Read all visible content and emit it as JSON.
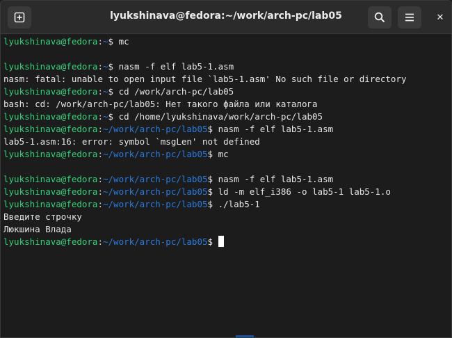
{
  "window": {
    "title": "lyukshinava@fedora:~/work/arch-pc/lab05",
    "buttons": {
      "new_tab_icon": "plus-square-icon",
      "search_icon": "search-icon",
      "menu_icon": "hamburger-icon",
      "close_icon": "close-icon",
      "close_glyph": "✕"
    }
  },
  "terminal": {
    "lines": [
      {
        "user": "lyukshinava@fedora",
        "sep": ":",
        "path": "~",
        "cmd": "$ mc"
      },
      {
        "text": ""
      },
      {
        "user": "lyukshinava@fedora",
        "sep": ":",
        "path": "~",
        "cmd": "$ nasm -f elf lab5-1.asm"
      },
      {
        "text": "nasm: fatal: unable to open input file `lab5-1.asm' No such file or directory"
      },
      {
        "user": "lyukshinava@fedora",
        "sep": ":",
        "path": "~",
        "cmd": "$ cd /work/arch-pc/lab05"
      },
      {
        "text": "bash: cd: /work/arch-pc/lab05: Нет такого файла или каталога"
      },
      {
        "user": "lyukshinava@fedora",
        "sep": ":",
        "path": "~",
        "cmd": "$ cd /home/lyukshinava/work/arch-pc/lab05"
      },
      {
        "user": "lyukshinava@fedora",
        "sep": ":",
        "path": "~/work/arch-pc/lab05",
        "cmd": "$ nasm -f elf lab5-1.asm"
      },
      {
        "text": "lab5-1.asm:16: error: symbol `msgLen' not defined"
      },
      {
        "user": "lyukshinava@fedora",
        "sep": ":",
        "path": "~/work/arch-pc/lab05",
        "cmd": "$ mc"
      },
      {
        "text": ""
      },
      {
        "user": "lyukshinava@fedora",
        "sep": ":",
        "path": "~/work/arch-pc/lab05",
        "cmd": "$ nasm -f elf lab5-1.asm"
      },
      {
        "user": "lyukshinava@fedora",
        "sep": ":",
        "path": "~/work/arch-pc/lab05",
        "cmd": "$ ld -m elf_i386 -o lab5-1 lab5-1.o"
      },
      {
        "user": "lyukshinava@fedora",
        "sep": ":",
        "path": "~/work/arch-pc/lab05",
        "cmd": "$ ./lab5-1"
      },
      {
        "text": "Введите строчку"
      },
      {
        "text": "Люкшина Влада"
      },
      {
        "user": "lyukshinava@fedora",
        "sep": ":",
        "path": "~/work/arch-pc/lab05",
        "cmd": "$ ",
        "cursor": true
      }
    ]
  },
  "colors": {
    "user": "#33d17a",
    "path": "#2a7bde",
    "text": "#e6e6e6",
    "background": "#1c1c1c"
  }
}
